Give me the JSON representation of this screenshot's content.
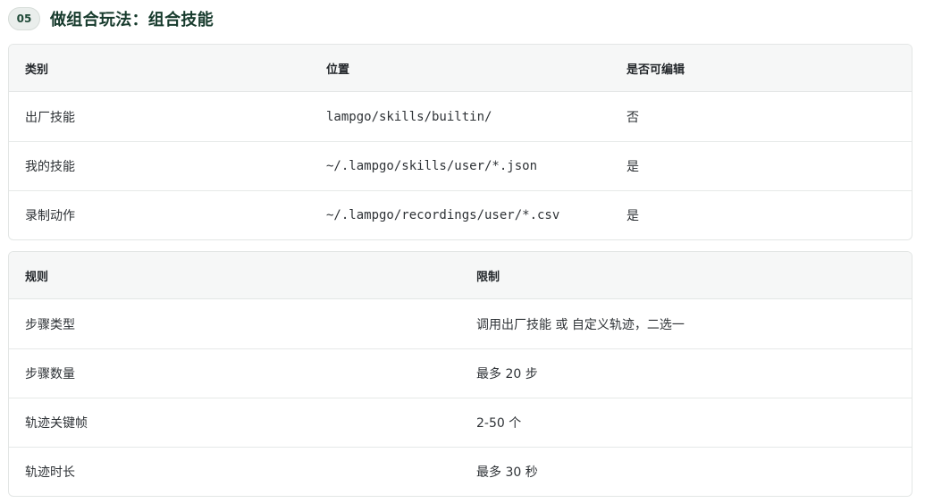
{
  "section": {
    "number": "05",
    "title": "做组合玩法：组合技能"
  },
  "table1": {
    "headers": [
      "类别",
      "位置",
      "是否可编辑"
    ],
    "rows": [
      [
        "出厂技能",
        "lampgo/skills/builtin/",
        "否"
      ],
      [
        "我的技能",
        "~/.lampgo/skills/user/*.json",
        "是"
      ],
      [
        "录制动作",
        "~/.lampgo/recordings/user/*.csv",
        "是"
      ]
    ]
  },
  "table2": {
    "headers": [
      "规则",
      "限制"
    ],
    "rows": [
      [
        "步骤类型",
        "调用出厂技能 或 自定义轨迹，二选一"
      ],
      [
        "步骤数量",
        "最多 20 步"
      ],
      [
        "轨迹关键帧",
        "2-50 个"
      ],
      [
        "轨迹时长",
        "最多 30 秒"
      ]
    ]
  }
}
